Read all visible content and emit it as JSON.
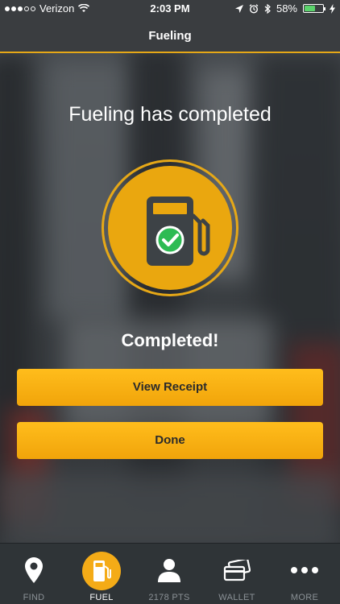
{
  "status_bar": {
    "carrier": "Verizon",
    "time": "2:03 PM",
    "battery": "58%",
    "battery_level": 0.58
  },
  "header": {
    "title": "Fueling"
  },
  "main": {
    "headline": "Fueling has completed",
    "status_text": "Completed!",
    "view_receipt_label": "View Receipt",
    "done_label": "Done"
  },
  "tabs": [
    {
      "label": "FIND",
      "icon": "map-pin-icon"
    },
    {
      "label": "FUEL",
      "icon": "fuel-pump-icon",
      "active": true
    },
    {
      "label": "2178 PTS",
      "icon": "person-icon"
    },
    {
      "label": "WALLET",
      "icon": "cards-icon"
    },
    {
      "label": "MORE",
      "icon": "more-dots-icon"
    }
  ],
  "colors": {
    "accent": "#f4ab17",
    "header_bg": "#3a3d40",
    "tabbar_bg": "#2f3437",
    "check_green": "#2dbb53"
  }
}
